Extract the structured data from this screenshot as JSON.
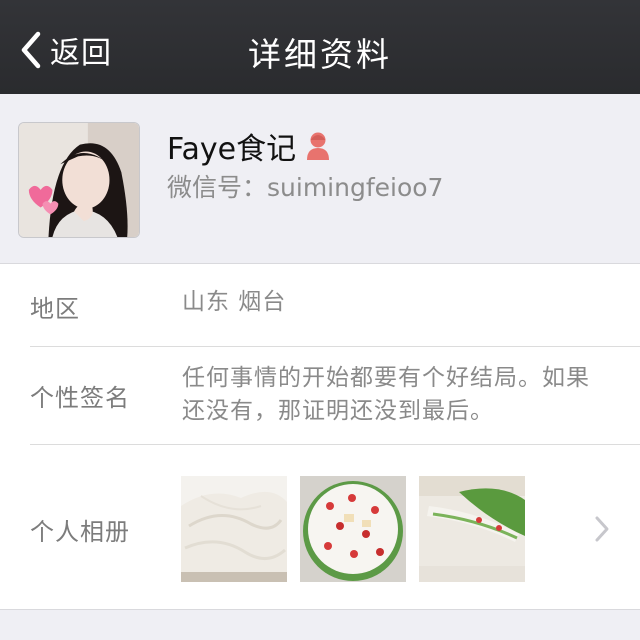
{
  "navbar": {
    "back_label": "返回",
    "title": "详细资料"
  },
  "profile": {
    "nickname": "Faye食记",
    "gender_icon": "female-icon",
    "wechat_id": "微信号：suimingfeioo7"
  },
  "details": {
    "region_label": "地区",
    "region_value": "山东 烟台",
    "signature_label": "个性签名",
    "signature_value": "任何事情的开始都要有个好结局。如果还没有，那证明还没到最后。",
    "album_label": "个人相册"
  },
  "colors": {
    "navbar": "#2f3033",
    "background": "#efeff4",
    "gender_icon": "#e8736e"
  }
}
